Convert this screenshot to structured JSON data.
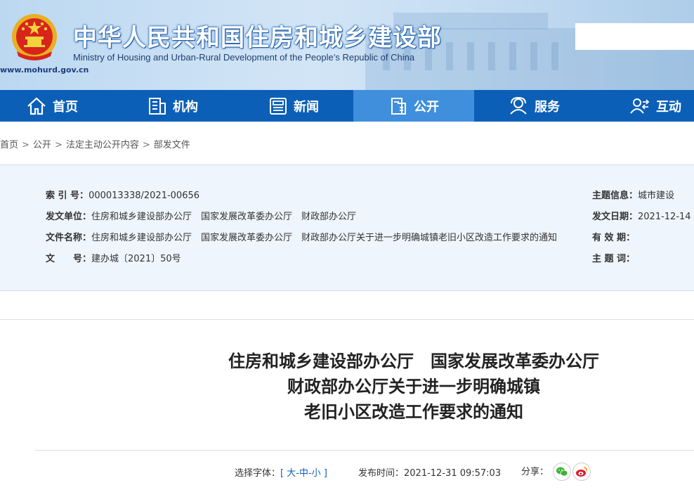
{
  "header": {
    "title_cn": "中华人民共和国住房和城乡建设部",
    "title_en": "Ministry of Housing and Urban-Rural Development of the People’s Republic of China",
    "site_url": "www.mohurd.gov.cn"
  },
  "nav": {
    "items": [
      {
        "label": "首页",
        "icon": "home-icon"
      },
      {
        "label": "机构",
        "icon": "building-icon"
      },
      {
        "label": "新闻",
        "icon": "news-icon"
      },
      {
        "label": "公开",
        "icon": "document-icon",
        "active": true
      },
      {
        "label": "服务",
        "icon": "service-icon"
      },
      {
        "label": "互动",
        "icon": "interaction-icon"
      }
    ]
  },
  "breadcrumb": [
    "首页",
    "公开",
    "法定主动公开内容",
    "部发文件"
  ],
  "info": {
    "index_label": "索 引 号：",
    "index_value": "000013338/2021-00656",
    "issuer_label": "发文单位：",
    "issuers": [
      "住房和城乡建设部办公厅",
      "国家发展改革委办公厅",
      "财政部办公厅"
    ],
    "docname_label": "文件名称：",
    "docname_parts": [
      "住房和城乡建设部办公厅",
      "国家发展改革委办公厅",
      "财政部办公厅关于进一步明确城镇老旧小区改造工作要求的通知"
    ],
    "docno_label": "文　　号：",
    "docno_value": "建办城〔2021〕50号",
    "topic_label": "主题信息：",
    "topic_value": "城市建设",
    "date_label": "发文日期：",
    "date_value": "2021-12-14",
    "validity_label": "有 效 期：",
    "validity_value": "",
    "keyword_label": "主 题 词：",
    "keyword_value": ""
  },
  "article": {
    "title_lines": [
      "住房和城乡建设部办公厅　国家发展改革委办公厅",
      "财政部办公厅关于进一步明确城镇",
      "老旧小区改造工作要求的通知"
    ],
    "font_label": "选择字体：",
    "font_bracket_open": "[",
    "font_large": "大",
    "font_medium": "中",
    "font_small": "小",
    "font_dash": "-",
    "font_bracket_close": "]",
    "publish_label": "发布时间：",
    "publish_time": "2021-12-31 09:57:03",
    "share_label": "分享：",
    "share_icons": [
      "wechat-icon",
      "weibo-icon"
    ]
  },
  "colors": {
    "nav_bg": "#0b5fb7",
    "nav_active": "#3f8fdc",
    "info_bg": "#eef5fc",
    "link_blue": "#0b5fb7"
  }
}
